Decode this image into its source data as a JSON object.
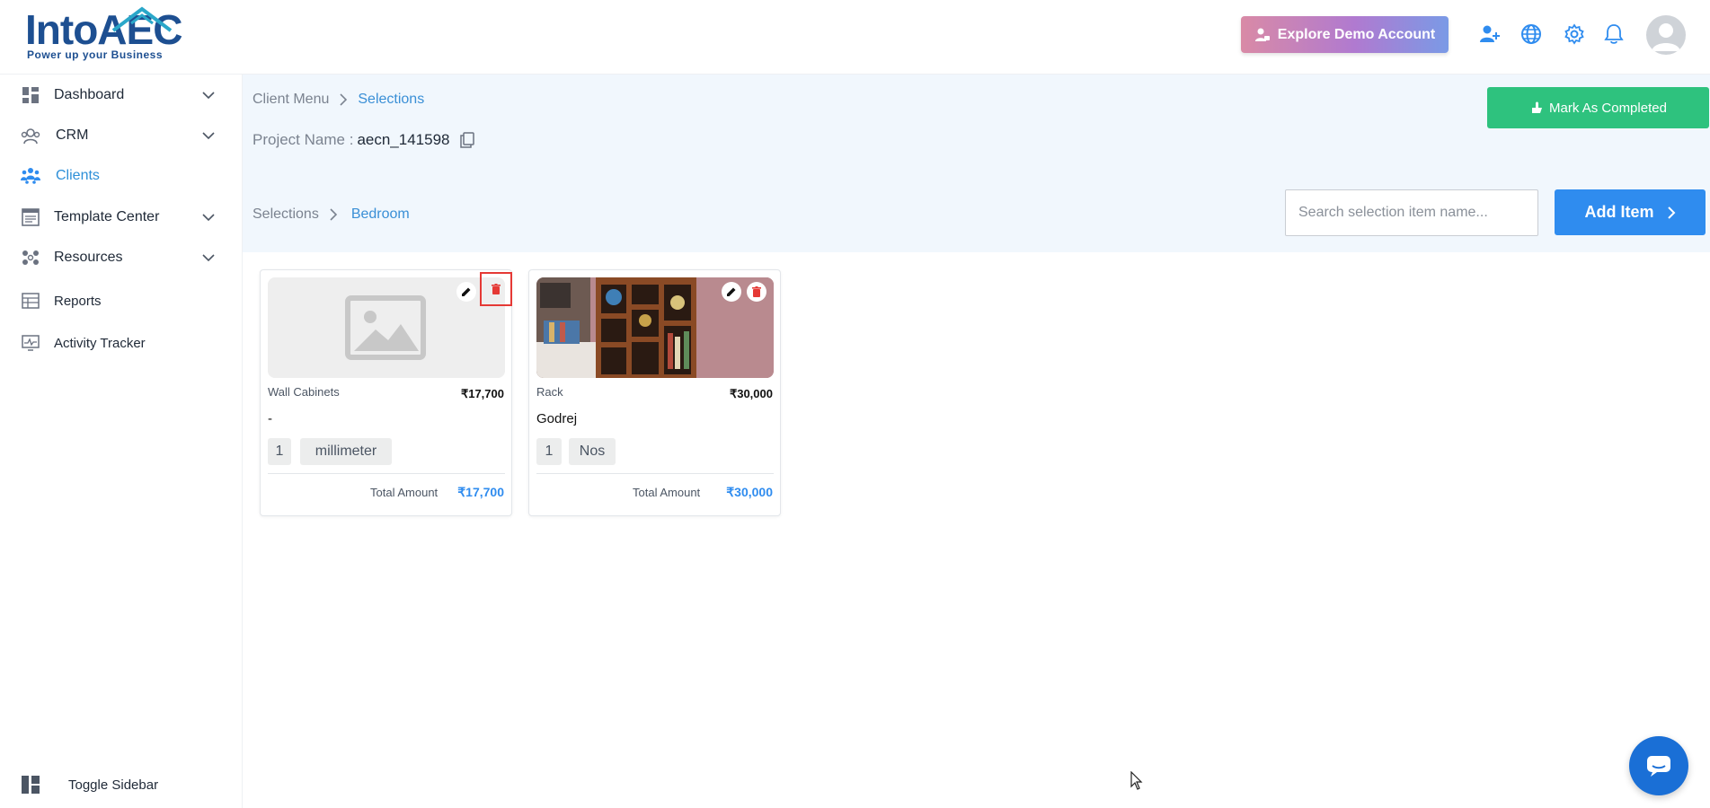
{
  "header": {
    "logo_text": "IntoAEC",
    "logo_tagline": "Power up your Business",
    "demo_button": "Explore Demo Account"
  },
  "sidebar": {
    "items": [
      {
        "label": "Dashboard",
        "icon": "dashboard-icon",
        "has_chevron": true
      },
      {
        "label": "CRM",
        "icon": "crm-icon",
        "has_chevron": true
      },
      {
        "label": "Clients",
        "icon": "clients-icon",
        "has_chevron": false,
        "active": true
      },
      {
        "label": "Template Center",
        "icon": "template-icon",
        "has_chevron": true
      },
      {
        "label": "Resources",
        "icon": "resources-icon",
        "has_chevron": true
      },
      {
        "label": "Reports",
        "icon": "reports-icon",
        "has_chevron": false
      },
      {
        "label": "Activity Tracker",
        "icon": "activity-icon",
        "has_chevron": false
      }
    ],
    "toggle_label": "Toggle Sidebar"
  },
  "main": {
    "breadcrumb": {
      "parent": "Client Menu",
      "current": "Selections"
    },
    "project_label": "Project Name :",
    "project_value": "aecn_141598",
    "mark_completed": "Mark As Completed",
    "sub_breadcrumb": {
      "parent": "Selections",
      "current": "Bedroom"
    },
    "search_placeholder": "Search selection item name...",
    "add_item": "Add Item"
  },
  "cards": [
    {
      "category": "Wall Cabinets",
      "price": "₹17,700",
      "brand": "-",
      "qty": "1",
      "unit": "millimeter",
      "total_label": "Total Amount",
      "total_value": "₹17,700",
      "has_image": false
    },
    {
      "category": "Rack",
      "price": "₹30,000",
      "brand": "Godrej",
      "qty": "1",
      "unit": "Nos",
      "total_label": "Total Amount",
      "total_value": "₹30,000",
      "has_image": true
    }
  ],
  "colors": {
    "accent": "#2f8cef",
    "success": "#2ec27e",
    "danger": "#e53935",
    "subhead_bg": "#f1f7fd"
  }
}
